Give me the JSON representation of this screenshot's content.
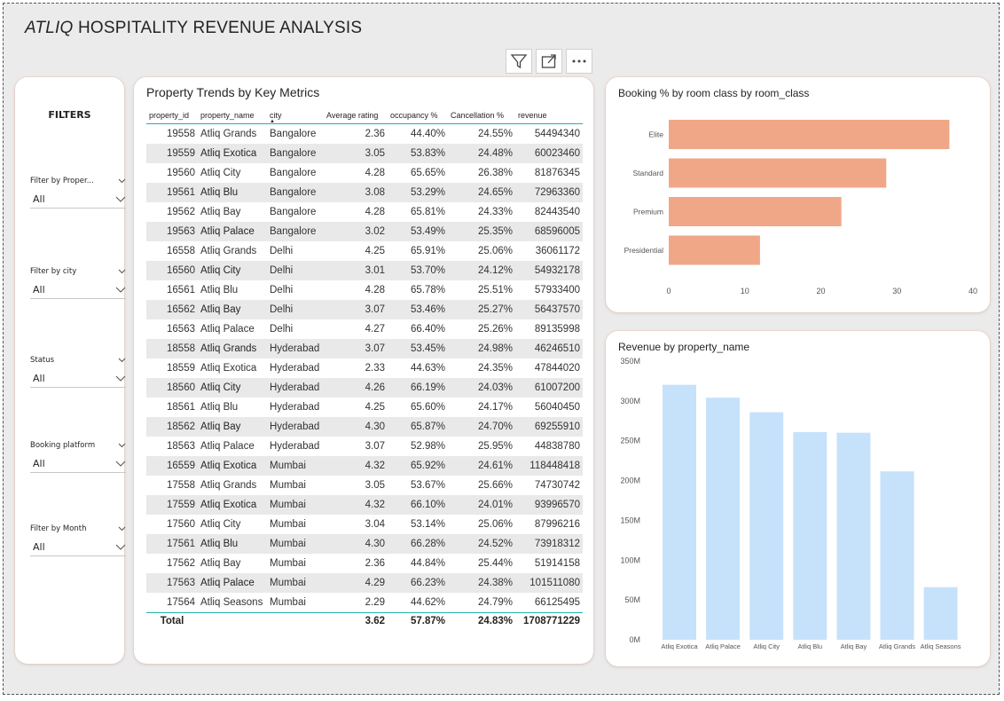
{
  "report_title": {
    "brand": "ATLIQ",
    "rest": "HOSPITALITY REVENUE ANALYSIS"
  },
  "toolbar": {
    "icons": [
      "filter-icon",
      "focus-mode-icon",
      "more-options-icon"
    ]
  },
  "filters": {
    "title": "FILTERS",
    "slicers": [
      {
        "label": "Filter by Proper...",
        "value": "All"
      },
      {
        "label": "Filter by city",
        "value": "All"
      },
      {
        "label": "Status",
        "value": "All"
      },
      {
        "label": "Booking platform",
        "value": "All"
      },
      {
        "label": "Filter by Month",
        "value": "All"
      }
    ]
  },
  "table": {
    "title": "Property Trends by Key Metrics",
    "columns": [
      "property_id",
      "property_name",
      "city",
      "Average rating",
      "occupancy %",
      "Cancellation %",
      "revenue"
    ],
    "rows": [
      [
        "19558",
        "Atliq Grands",
        "Bangalore",
        "2.36",
        "44.40%",
        "24.55%",
        "54494340"
      ],
      [
        "19559",
        "Atliq Exotica",
        "Bangalore",
        "3.05",
        "53.83%",
        "24.48%",
        "60023460"
      ],
      [
        "19560",
        "Atliq City",
        "Bangalore",
        "4.28",
        "65.65%",
        "26.38%",
        "81876345"
      ],
      [
        "19561",
        "Atliq Blu",
        "Bangalore",
        "3.08",
        "53.29%",
        "24.65%",
        "72963360"
      ],
      [
        "19562",
        "Atliq Bay",
        "Bangalore",
        "4.28",
        "65.81%",
        "24.33%",
        "82443540"
      ],
      [
        "19563",
        "Atliq Palace",
        "Bangalore",
        "3.02",
        "53.49%",
        "25.35%",
        "68596005"
      ],
      [
        "16558",
        "Atliq Grands",
        "Delhi",
        "4.25",
        "65.91%",
        "25.06%",
        "36061172"
      ],
      [
        "16560",
        "Atliq City",
        "Delhi",
        "3.01",
        "53.70%",
        "24.12%",
        "54932178"
      ],
      [
        "16561",
        "Atliq Blu",
        "Delhi",
        "4.28",
        "65.78%",
        "25.51%",
        "57933400"
      ],
      [
        "16562",
        "Atliq Bay",
        "Delhi",
        "3.07",
        "53.46%",
        "25.27%",
        "56437570"
      ],
      [
        "16563",
        "Atliq Palace",
        "Delhi",
        "4.27",
        "66.40%",
        "25.26%",
        "89135998"
      ],
      [
        "18558",
        "Atliq Grands",
        "Hyderabad",
        "3.07",
        "53.45%",
        "24.98%",
        "46246510"
      ],
      [
        "18559",
        "Atliq Exotica",
        "Hyderabad",
        "2.33",
        "44.63%",
        "24.35%",
        "47844020"
      ],
      [
        "18560",
        "Atliq City",
        "Hyderabad",
        "4.26",
        "66.19%",
        "24.03%",
        "61007200"
      ],
      [
        "18561",
        "Atliq Blu",
        "Hyderabad",
        "4.25",
        "65.60%",
        "24.17%",
        "56040450"
      ],
      [
        "18562",
        "Atliq Bay",
        "Hyderabad",
        "4.30",
        "65.87%",
        "24.70%",
        "69255910"
      ],
      [
        "18563",
        "Atliq Palace",
        "Hyderabad",
        "3.07",
        "52.98%",
        "25.95%",
        "44838780"
      ],
      [
        "16559",
        "Atliq Exotica",
        "Mumbai",
        "4.32",
        "65.92%",
        "24.61%",
        "118448418"
      ],
      [
        "17558",
        "Atliq Grands",
        "Mumbai",
        "3.05",
        "53.67%",
        "25.66%",
        "74730742"
      ],
      [
        "17559",
        "Atliq Exotica",
        "Mumbai",
        "4.32",
        "66.10%",
        "24.01%",
        "93996570"
      ],
      [
        "17560",
        "Atliq City",
        "Mumbai",
        "3.04",
        "53.14%",
        "25.06%",
        "87996216"
      ],
      [
        "17561",
        "Atliq Blu",
        "Mumbai",
        "4.30",
        "66.28%",
        "24.52%",
        "73918312"
      ],
      [
        "17562",
        "Atliq Bay",
        "Mumbai",
        "2.36",
        "44.84%",
        "25.44%",
        "51914158"
      ],
      [
        "17563",
        "Atliq Palace",
        "Mumbai",
        "4.29",
        "66.23%",
        "24.38%",
        "101511080"
      ],
      [
        "17564",
        "Atliq Seasons",
        "Mumbai",
        "2.29",
        "44.62%",
        "24.79%",
        "66125495"
      ]
    ],
    "total": [
      "Total",
      "",
      "",
      "3.62",
      "57.87%",
      "24.83%",
      "1708771229"
    ]
  },
  "colors": {
    "booking_bar": "#f0a787",
    "revenue_bar": "#c6e2fb",
    "accent_line": "#20b2aa"
  },
  "chart_data": [
    {
      "type": "bar",
      "orientation": "horizontal",
      "title": "Booking % by room class by room_class",
      "categories": [
        "Elite",
        "Standard",
        "Premium",
        "Presidential"
      ],
      "values": [
        36.9,
        28.6,
        22.7,
        12.0
      ],
      "ticks": [
        "0",
        "10",
        "20",
        "30",
        "40"
      ],
      "xlim": [
        0,
        40
      ],
      "grid": false
    },
    {
      "type": "bar",
      "orientation": "vertical",
      "title": "Revenue by property_name",
      "categories": [
        "Atliq Exotica",
        "Atliq Palace",
        "Atliq City",
        "Atliq Blu",
        "Atliq Bay",
        "Atliq Grands",
        "Atliq Seasons"
      ],
      "values": [
        320300000,
        304100000,
        285800000,
        260900000,
        260100000,
        211500000,
        66100000
      ],
      "ticks": [
        "0M",
        "50M",
        "100M",
        "150M",
        "200M",
        "250M",
        "300M",
        "350M"
      ],
      "ylim": [
        0,
        350000000
      ],
      "grid": false
    }
  ]
}
